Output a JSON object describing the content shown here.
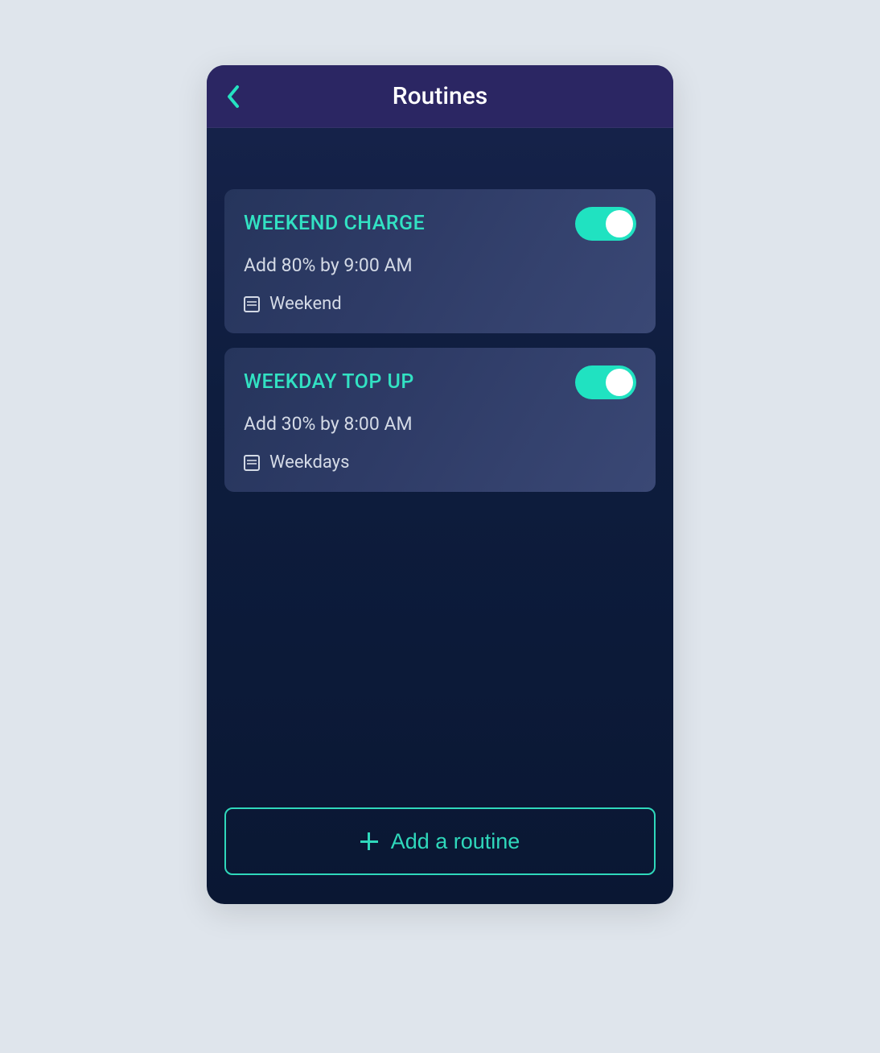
{
  "header": {
    "title": "Routines"
  },
  "routines": [
    {
      "name": "WEEKEND CHARGE",
      "description": "Add 80% by 9:00 AM",
      "schedule": "Weekend",
      "enabled": true
    },
    {
      "name": "WEEKDAY TOP UP",
      "description": "Add 30% by 8:00 AM",
      "schedule": "Weekdays",
      "enabled": true
    }
  ],
  "footer": {
    "add_label": "Add a routine"
  }
}
